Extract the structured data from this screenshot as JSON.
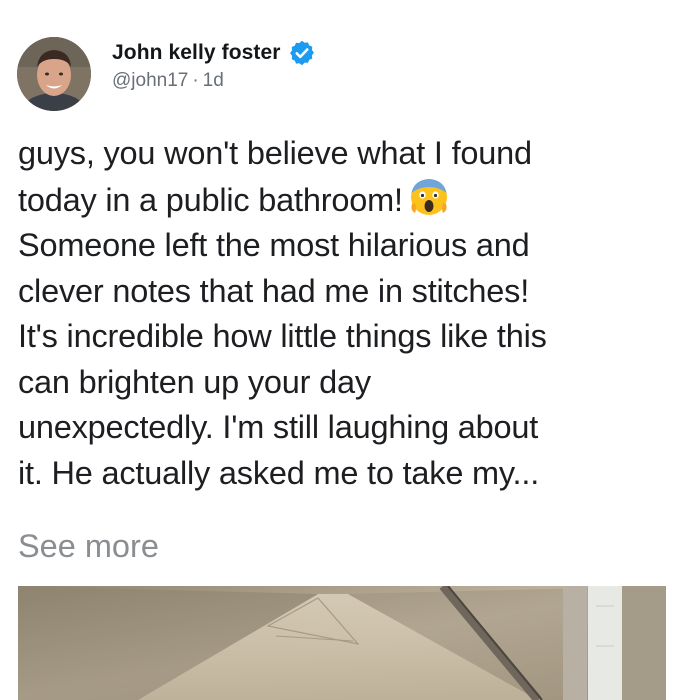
{
  "author": {
    "name": "John kelly foster",
    "handle": "@john17",
    "separator": "·",
    "time": "1d",
    "verified": true
  },
  "post": {
    "lines": [
      "guys, you won't believe what I found",
      "today in a public bathroom!",
      "Someone left the most hilarious and",
      "clever notes that had me in stitches!",
      "It's incredible how little things like this",
      "can brighten up your day",
      "unexpectedly. I'm still laughing about",
      "it. He actually asked me to take my..."
    ],
    "emoji": "face-screaming-in-fear",
    "see_more": "See more"
  },
  "colors": {
    "verified_blue": "#1d9bf0",
    "text": "#1c1e21",
    "muted": "#6a6f75",
    "see_more": "#8a8d91"
  },
  "icons": {
    "verified": "verified-badge-icon",
    "emoji": "screaming-face-emoji-icon"
  }
}
